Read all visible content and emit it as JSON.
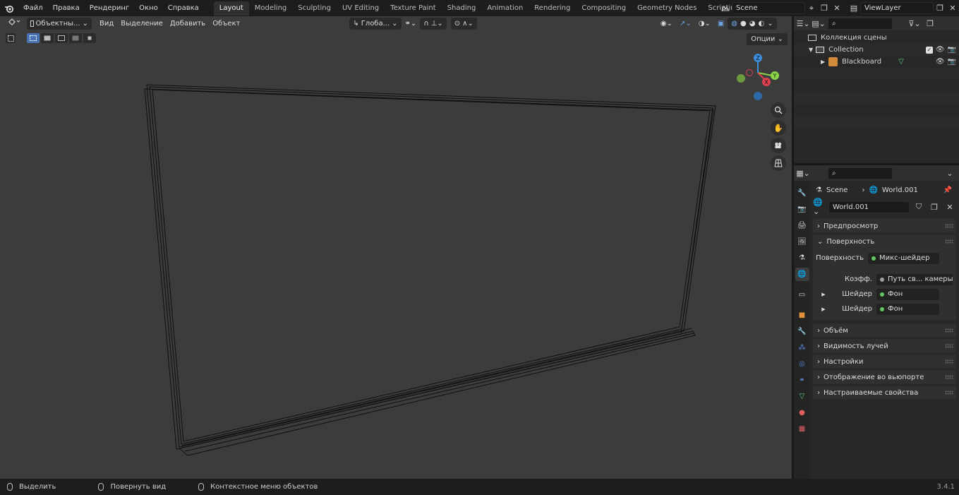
{
  "topbar": {
    "menus": [
      "Файл",
      "Правка",
      "Рендеринг",
      "Окно",
      "Справка"
    ],
    "workspaces": [
      "Layout",
      "Modeling",
      "Sculpting",
      "UV Editing",
      "Texture Paint",
      "Shading",
      "Animation",
      "Rendering",
      "Compositing",
      "Geometry Nodes",
      "Scripting"
    ],
    "active_workspace": "Layout",
    "scene_name": "Scene",
    "view_layer": "ViewLayer"
  },
  "viewport": {
    "mode": "Объектны...",
    "menus": [
      "Вид",
      "Выделение",
      "Добавить",
      "Объект"
    ],
    "transform_orientation": "Глоба...",
    "options_label": "Опции",
    "gizmo_axes": {
      "x": "X",
      "y": "Y",
      "z": "Z"
    }
  },
  "outliner": {
    "rows": [
      {
        "label": "Коллекция сцены",
        "icon": "scene-collection-icon"
      },
      {
        "label": "Collection",
        "icon": "collection-icon"
      },
      {
        "label": "Blackboard",
        "icon": "mesh-object-icon"
      }
    ]
  },
  "properties": {
    "breadcrumb": {
      "scene": "Scene",
      "world": "World.001"
    },
    "world_name": "World.001",
    "panels": {
      "preview": "Предпросмотр",
      "surface": "Поверхность",
      "volume": "Объём",
      "ray_visibility": "Видимость лучей",
      "settings": "Настройки",
      "viewport_display": "Отображение во вьюпорте",
      "custom_props": "Настраиваемые свойства"
    },
    "surface_rows": [
      {
        "label": "Поверхность",
        "value": "Микс-шейдер",
        "dot": "green"
      },
      {
        "label": "Коэфф.",
        "value": "Путь св... камеры",
        "dot": "grey"
      },
      {
        "label": "Шейдер",
        "value": "Фон",
        "dot": "green"
      },
      {
        "label": "Шейдер",
        "value": "Фон",
        "dot": "green"
      }
    ]
  },
  "statusbar": {
    "select": "Выделить",
    "rotate": "Повернуть вид",
    "context": "Контекстное меню объектов",
    "version": "3.4.1"
  },
  "colors": {
    "accent": "#4772b3",
    "axis_x": "#e0404f",
    "axis_y": "#8bd448",
    "axis_z": "#3d8ddb",
    "socket": "#63c763"
  }
}
